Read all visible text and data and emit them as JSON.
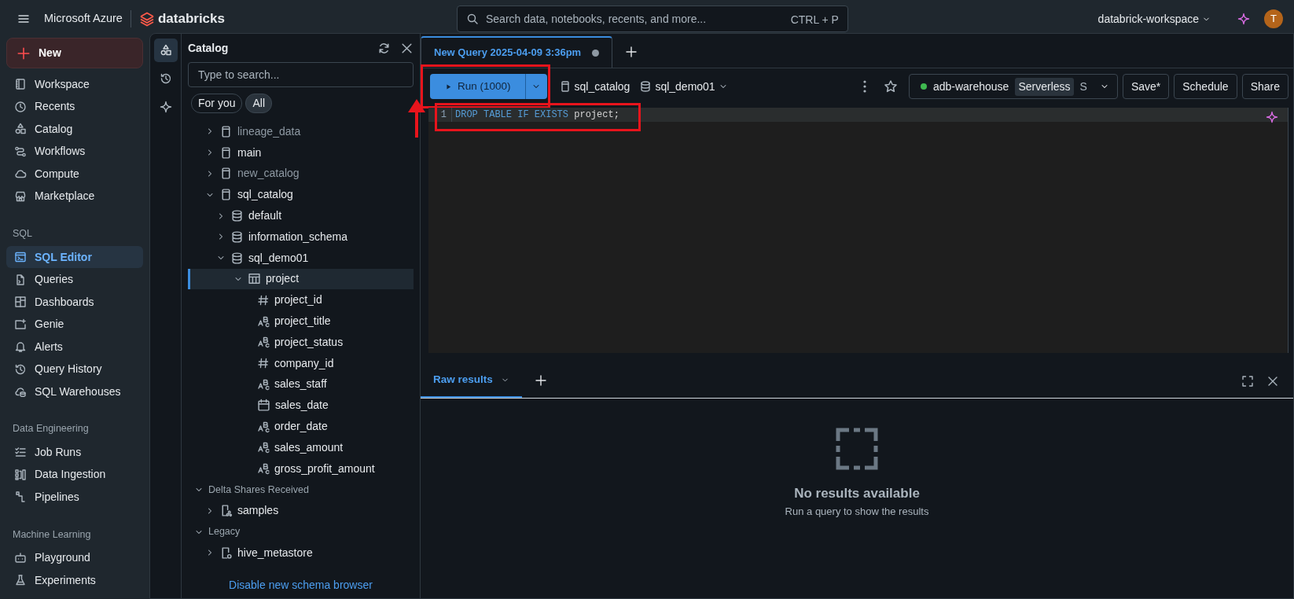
{
  "topbar": {
    "brand": "Microsoft Azure",
    "product": "databricks",
    "search_placeholder": "Search data, notebooks, recents, and more...",
    "shortcut": "CTRL + P",
    "workspace": "databrick-workspace",
    "avatar": "T"
  },
  "sidebar": {
    "new_label": "New",
    "sections": [
      {
        "items": [
          {
            "label": "Workspace",
            "selected": false
          },
          {
            "label": "Recents",
            "selected": false
          },
          {
            "label": "Catalog",
            "selected": false
          },
          {
            "label": "Workflows",
            "selected": false
          },
          {
            "label": "Compute",
            "selected": false
          },
          {
            "label": "Marketplace",
            "selected": false
          }
        ]
      },
      {
        "title": "SQL",
        "items": [
          {
            "label": "SQL Editor",
            "selected": true
          },
          {
            "label": "Queries",
            "selected": false
          },
          {
            "label": "Dashboards",
            "selected": false
          },
          {
            "label": "Genie",
            "selected": false
          },
          {
            "label": "Alerts",
            "selected": false
          },
          {
            "label": "Query History",
            "selected": false
          },
          {
            "label": "SQL Warehouses",
            "selected": false
          }
        ]
      },
      {
        "title": "Data Engineering",
        "items": [
          {
            "label": "Job Runs",
            "selected": false
          },
          {
            "label": "Data Ingestion",
            "selected": false
          },
          {
            "label": "Pipelines",
            "selected": false
          }
        ]
      },
      {
        "title": "Machine Learning",
        "items": [
          {
            "label": "Playground",
            "selected": false
          },
          {
            "label": "Experiments",
            "selected": false
          }
        ]
      }
    ]
  },
  "rail": [
    {
      "selected": true
    },
    {
      "selected": false
    },
    {
      "selected": false
    }
  ],
  "catalog": {
    "title": "Catalog",
    "search_placeholder": "Type to search...",
    "filters": [
      {
        "label": "For you",
        "selected": false
      },
      {
        "label": "All",
        "selected": true
      }
    ],
    "tree": [
      {
        "kind": "catalog",
        "label": "lineage_data",
        "expanded": false,
        "dimmed": true,
        "selected": false
      },
      {
        "kind": "catalog",
        "label": "main",
        "expanded": false,
        "dimmed": false,
        "selected": false
      },
      {
        "kind": "catalog",
        "label": "new_catalog",
        "expanded": false,
        "dimmed": true,
        "selected": false
      },
      {
        "kind": "catalog",
        "label": "sql_catalog",
        "expanded": true,
        "dimmed": false,
        "selected": false,
        "children": [
          {
            "kind": "schema",
            "label": "default",
            "expanded": false,
            "dimmed": false,
            "selected": false
          },
          {
            "kind": "schema",
            "label": "information_schema",
            "expanded": false,
            "dimmed": false,
            "selected": false
          },
          {
            "kind": "schema",
            "label": "sql_demo01",
            "expanded": true,
            "dimmed": false,
            "selected": false,
            "children": [
              {
                "kind": "table",
                "label": "project",
                "expanded": true,
                "dimmed": false,
                "selected": true,
                "children": [
                  {
                    "kind": "number",
                    "label": "project_id",
                    "dimmed": false,
                    "selected": false
                  },
                  {
                    "kind": "string",
                    "label": "project_title",
                    "dimmed": false,
                    "selected": false
                  },
                  {
                    "kind": "string",
                    "label": "project_status",
                    "dimmed": false,
                    "selected": false
                  },
                  {
                    "kind": "number",
                    "label": "company_id",
                    "dimmed": false,
                    "selected": false
                  },
                  {
                    "kind": "string",
                    "label": "sales_staff",
                    "dimmed": false,
                    "selected": false
                  },
                  {
                    "kind": "date",
                    "label": "sales_date",
                    "dimmed": false,
                    "selected": false
                  },
                  {
                    "kind": "string",
                    "label": "order_date",
                    "dimmed": false,
                    "selected": false
                  },
                  {
                    "kind": "string",
                    "label": "sales_amount",
                    "dimmed": false,
                    "selected": false
                  },
                  {
                    "kind": "string",
                    "label": "gross_profit_amount",
                    "dimmed": false,
                    "selected": false
                  }
                ]
              }
            ]
          }
        ]
      },
      {
        "kind": "group",
        "label": "Delta Shares Received",
        "expanded": true,
        "dimmed": false,
        "selected": false,
        "children": [
          {
            "kind": "share",
            "label": "samples",
            "expanded": false,
            "dimmed": false,
            "selected": false
          }
        ]
      },
      {
        "kind": "group",
        "label": "Legacy",
        "expanded": true,
        "dimmed": false,
        "selected": false,
        "children": [
          {
            "kind": "legacy",
            "label": "hive_metastore",
            "expanded": false,
            "dimmed": false,
            "selected": false
          }
        ]
      }
    ],
    "footer_link": "Disable new schema browser"
  },
  "editor": {
    "tabs": [
      {
        "label": "New Query 2025-04-09 3:36pm",
        "selected": true,
        "unsaved": true
      }
    ],
    "run_button": {
      "label": "Run (1000)",
      "highlighted": true
    },
    "catalog": "sql_catalog",
    "schema": "sql_demo01",
    "warehouse": {
      "name": "adb-warehouse",
      "tag": "Serverless",
      "size": "S",
      "running": true
    },
    "buttons": [
      "Save*",
      "Schedule",
      "Share"
    ],
    "code": {
      "highlighted": true,
      "lines": [
        {
          "number": "1",
          "tokens": [
            {
              "kind": "keyword",
              "text": "DROP TABLE IF EXISTS"
            },
            {
              "kind": "plain",
              "text": "project;"
            }
          ]
        }
      ]
    }
  },
  "results": {
    "tabs": [
      {
        "label": "Raw results",
        "selected": true
      }
    ],
    "empty_title": "No results available",
    "empty_text": "Run a query to show the results"
  }
}
